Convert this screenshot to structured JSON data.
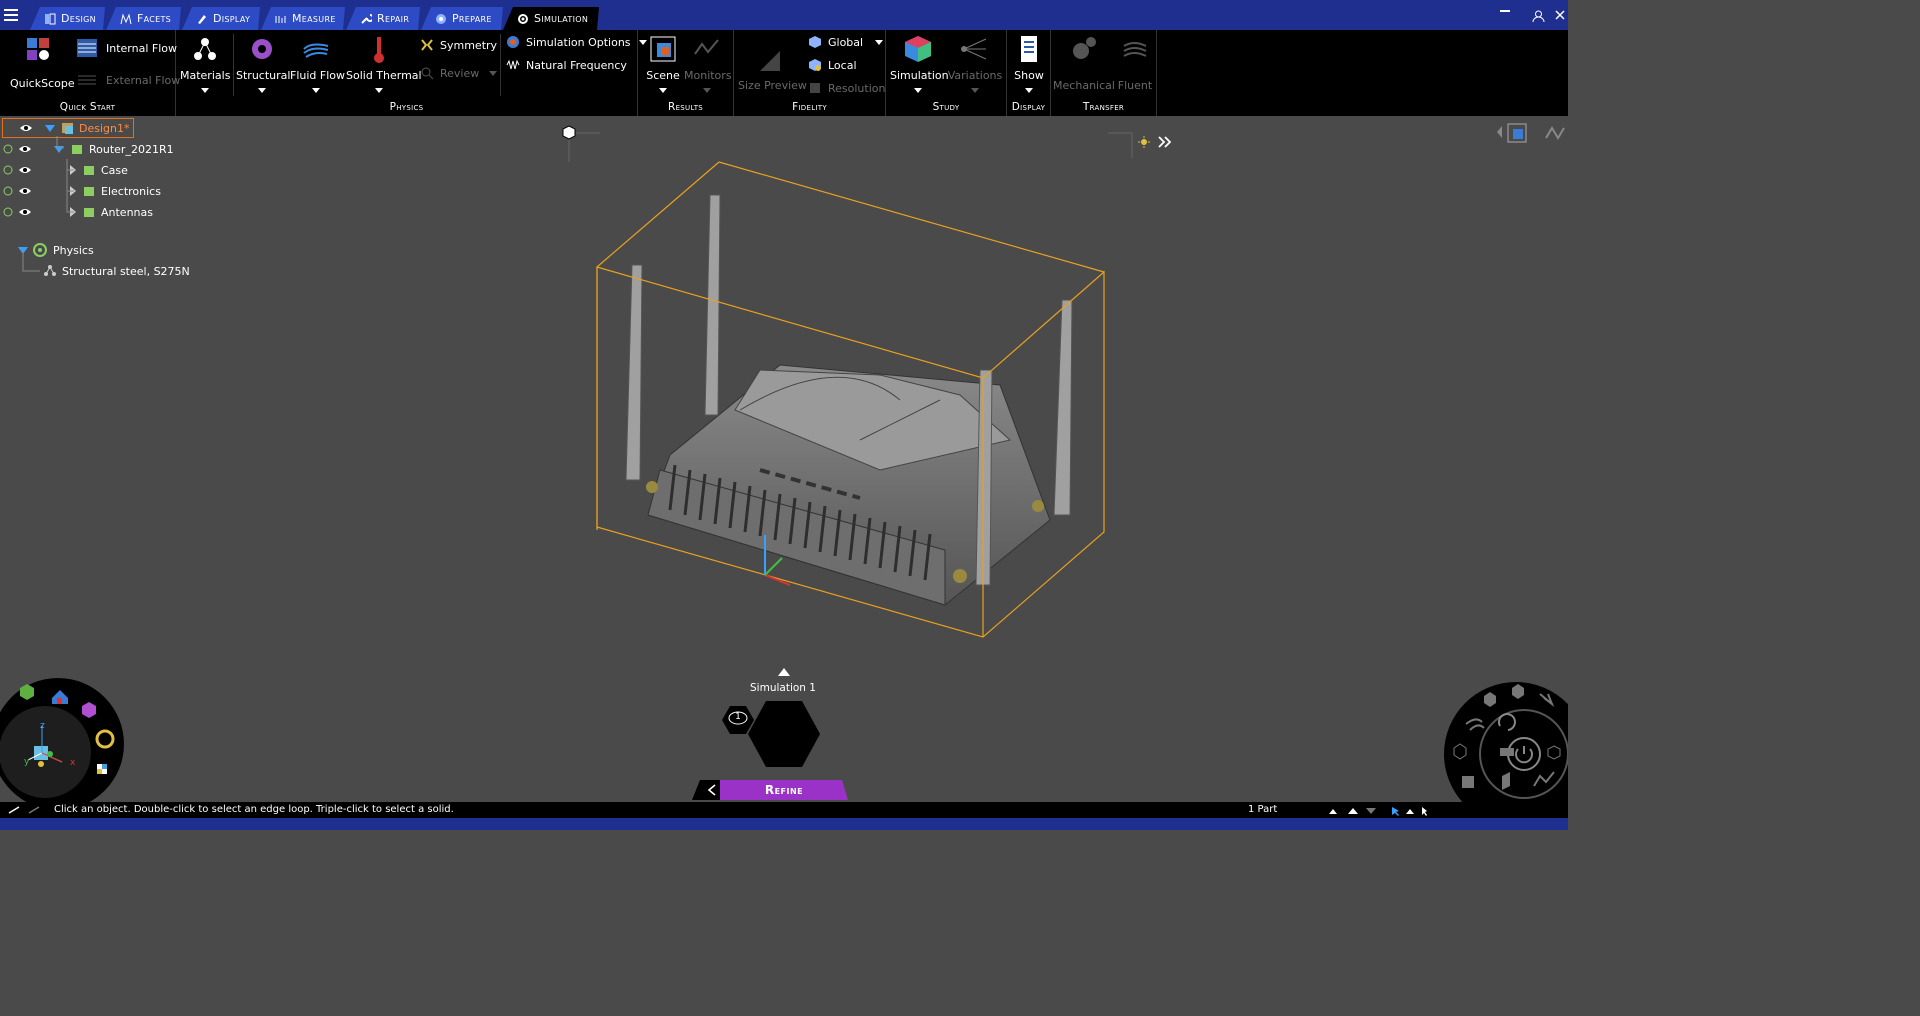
{
  "tabs": [
    {
      "label": "Design",
      "active": false
    },
    {
      "label": "Facets",
      "active": false
    },
    {
      "label": "Display",
      "active": false
    },
    {
      "label": "Measure",
      "active": false
    },
    {
      "label": "Repair",
      "active": false
    },
    {
      "label": "Prepare",
      "active": false
    },
    {
      "label": "Simulation",
      "active": true
    }
  ],
  "ribbon": {
    "quickstart": {
      "label": "Quick Start",
      "quickscope": "QuickScope",
      "internal_flow": "Internal Flow",
      "external_flow": "External Flow"
    },
    "physics": {
      "label": "Physics",
      "materials": "Materials",
      "structural": "Structural",
      "fluid_flow": "Fluid Flow",
      "solid_thermal": "Solid Thermal",
      "symmetry": "Symmetry",
      "review": "Review",
      "simulation_options": "Simulation Options",
      "natural_frequency": "Natural Frequency"
    },
    "results": {
      "label": "Results",
      "scene": "Scene",
      "monitors": "Monitors"
    },
    "fidelity": {
      "label": "Fidelity",
      "size_preview": "Size Preview",
      "global": "Global",
      "local": "Local",
      "resolution": "Resolution"
    },
    "study": {
      "label": "Study",
      "simulation": "Simulation",
      "variations": "Variations"
    },
    "display": {
      "label": "Display",
      "show": "Show"
    },
    "transfer": {
      "label": "Transfer",
      "mechanical": "Mechanical",
      "fluent": "Fluent"
    }
  },
  "tree": {
    "design": "Design1*",
    "router": "Router_2021R1",
    "case": "Case",
    "electronics": "Electronics",
    "antennas": "Antennas",
    "physics": "Physics",
    "material": "Structural steel, S275N"
  },
  "viewport": {
    "simulation_label": "Simulation 1",
    "badge_count": "1",
    "refine": "Refine"
  },
  "status": {
    "hint": "Click an object. Double-click to select an edge loop. Triple-click to select a solid.",
    "parts": "1 Part"
  },
  "axes": {
    "x": "x",
    "y": "y",
    "z": "z"
  },
  "colors": {
    "accent": "#2d4bc4",
    "selection": "#e8a020",
    "refine": "#9a32c8"
  }
}
